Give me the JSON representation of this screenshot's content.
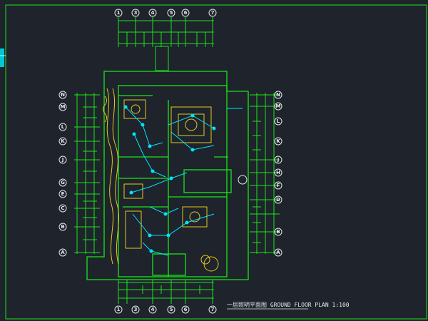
{
  "title_block": {
    "caption": "一层照明平面图 GROUND FLOOR PLAN 1:100"
  },
  "grid_axes": {
    "top": [
      "1",
      "3",
      "4",
      "5",
      "6",
      "7"
    ],
    "bottom": [
      "1",
      "3",
      "4",
      "5",
      "6",
      "7"
    ],
    "left": [
      "N",
      "M",
      "L",
      "K",
      "J",
      "G",
      "E",
      "C",
      "B",
      "A"
    ],
    "right": [
      "N",
      "M",
      "L",
      "K",
      "J",
      "H",
      "F",
      "D",
      "B",
      "A"
    ]
  },
  "colors": {
    "background": "#1e232c",
    "frame": "#19e619",
    "wall": "#19e619",
    "wiring": "#00e5ff",
    "furniture": "#e6c81e",
    "text": "#e8e8e8"
  }
}
